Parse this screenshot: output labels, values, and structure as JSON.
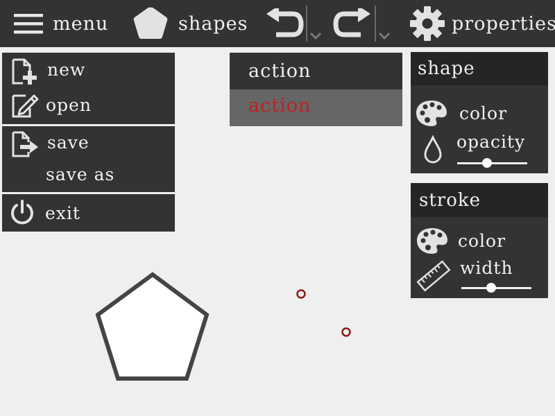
{
  "toolbar": {
    "menu_label": "menu",
    "shapes_label": "shapes",
    "properties_label": "properties"
  },
  "file_menu": {
    "new_label": "new",
    "open_label": "open",
    "save_label": "save",
    "save_as_label": "save as",
    "exit_label": "exit"
  },
  "action_menu": {
    "items": [
      "action",
      "action"
    ]
  },
  "shape_panel": {
    "title": "shape",
    "color_label": "color",
    "opacity_label": "opacity",
    "opacity_value": 0.43
  },
  "stroke_panel": {
    "title": "stroke",
    "color_label": "color",
    "width_label": "width",
    "width_value": 0.43
  },
  "colors": {
    "bar": "#333333",
    "panel_head": "#252525",
    "active_item_bg": "#666666",
    "active_item_text": "#c41e1e",
    "canvas_bg": "#efefef",
    "shape_stroke": "#444444",
    "handle": "#8b1a1a"
  },
  "icons": {
    "menu": "hamburger-icon",
    "shapes": "pentagon-icon",
    "undo": "undo-icon",
    "redo": "redo-icon",
    "properties": "gear-icon",
    "new": "new-file-icon",
    "open": "edit-file-icon",
    "save": "save-file-icon",
    "exit": "power-icon",
    "fill_color": "palette-icon",
    "opacity": "droplet-icon",
    "stroke_color": "palette-icon",
    "stroke_width": "ruler-icon"
  }
}
